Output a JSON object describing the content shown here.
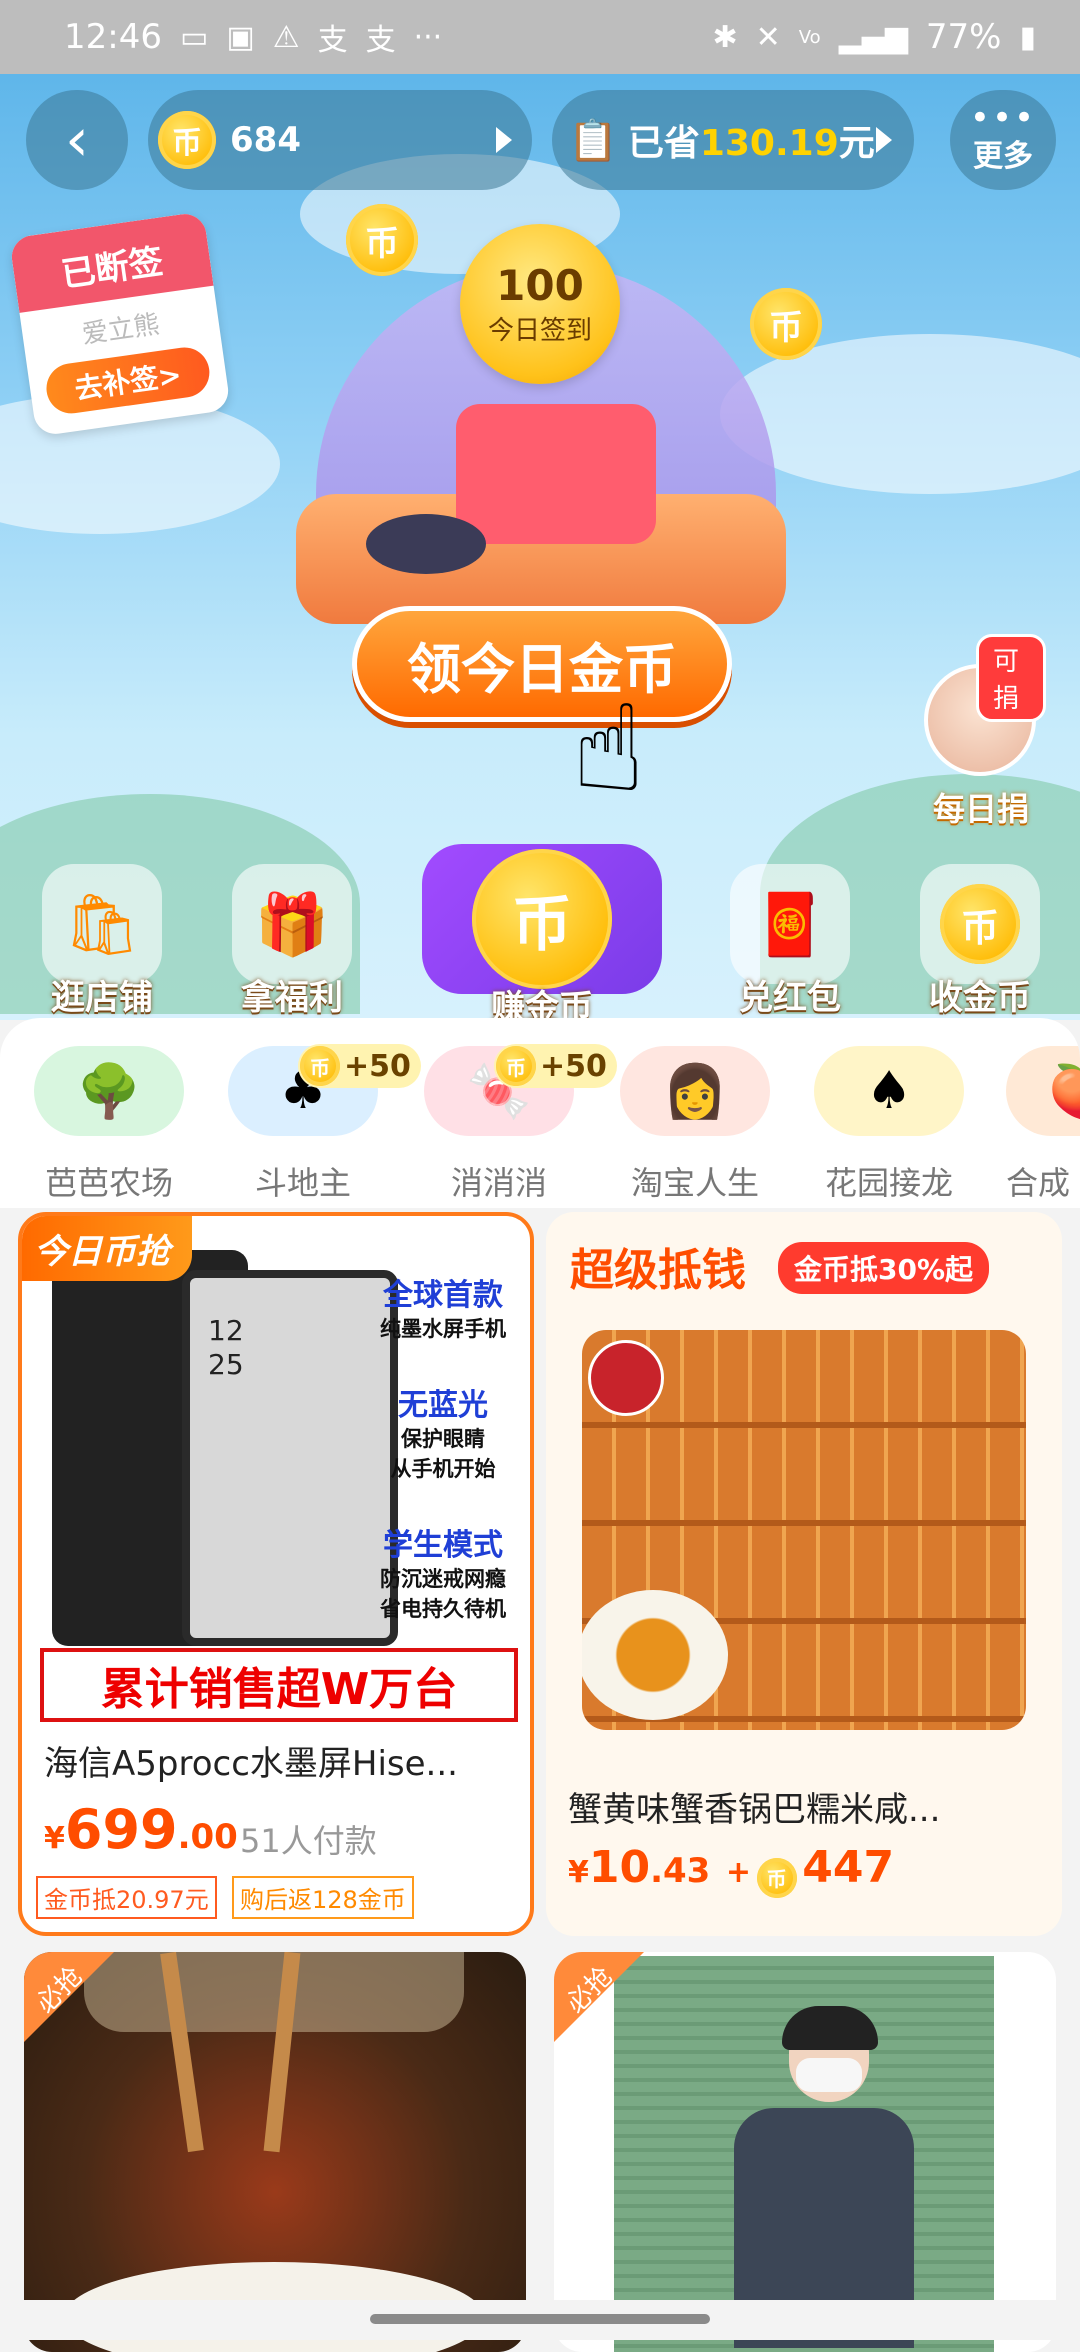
{
  "status_bar": {
    "time": "12:46",
    "left_icons": [
      "message-icon",
      "tv-icon",
      "warning-icon",
      "alipay-icon",
      "alipay-icon",
      "more-dots-icon"
    ],
    "battery": "77%",
    "right_icons": [
      "bluetooth-icon",
      "mute-icon",
      "volte-icon",
      "4g-icon",
      "signal-icon",
      "battery-icon"
    ]
  },
  "header": {
    "coin_count": "684",
    "saved_prefix": "已省",
    "saved_amount": "130.19",
    "saved_suffix": "元",
    "more_label": "更多"
  },
  "calendar": {
    "title": "已断签",
    "brand": "爱立熊",
    "button": "去补签>"
  },
  "sign_in": {
    "amount": "100",
    "label": "今日签到"
  },
  "claim_button": "领今日金币",
  "donate": {
    "badge": "可捐",
    "label": "每日捐"
  },
  "features": [
    {
      "label": "逛店铺",
      "icon": "shopping-bag-icon"
    },
    {
      "label": "拿福利",
      "icon": "gift-icon"
    },
    {
      "label": "赚金币",
      "icon": "coin-icon"
    },
    {
      "label": "兑红包",
      "icon": "red-envelope-icon"
    },
    {
      "label": "收金币",
      "icon": "coin-collect-icon"
    }
  ],
  "games": [
    {
      "label": "芭芭农场",
      "icon": "farm-tree-icon"
    },
    {
      "label": "斗地主",
      "icon": "card-club-icon",
      "bonus": "+50"
    },
    {
      "label": "消消消",
      "icon": "match-three-icon",
      "bonus": "+50"
    },
    {
      "label": "淘宝人生",
      "icon": "avatar-girl-icon"
    },
    {
      "label": "花园接龙",
      "icon": "card-spade-icon"
    },
    {
      "label": "合成",
      "icon": "fruit-icon"
    }
  ],
  "product1": {
    "tag": "今日币抢",
    "screen_time": "12\n25",
    "features": [
      {
        "head": "全球首款",
        "sub": "纯墨水屏手机"
      },
      {
        "head": "无蓝光",
        "sub": "保护眼睛\n从手机开始"
      },
      {
        "head": "学生模式",
        "sub": "防沉迷戒网瘾\n省电持久待机"
      }
    ],
    "banner": "累计销售超W万台",
    "title": "海信A5procc水墨屏Hise...",
    "currency": "¥",
    "price_int": "699",
    "price_dec": ".00",
    "paid": "51人付款",
    "chip1": "金币抵20.97元",
    "chip2": "购后返128金币"
  },
  "product2": {
    "section_title": "超级抵钱",
    "badge": "金币抵30%起",
    "title": "蟹黄味蟹香锅巴糯米咸...",
    "currency": "¥",
    "price_int": "10",
    "price_dec": ".43",
    "plus": "+",
    "coins": "447"
  },
  "product3": {
    "tag": "必抢"
  },
  "product4": {
    "tag": "必抢"
  },
  "colors": {
    "accent": "#ff6a00",
    "price": "#ff4d00",
    "sky_top": "#5fb6ea"
  }
}
